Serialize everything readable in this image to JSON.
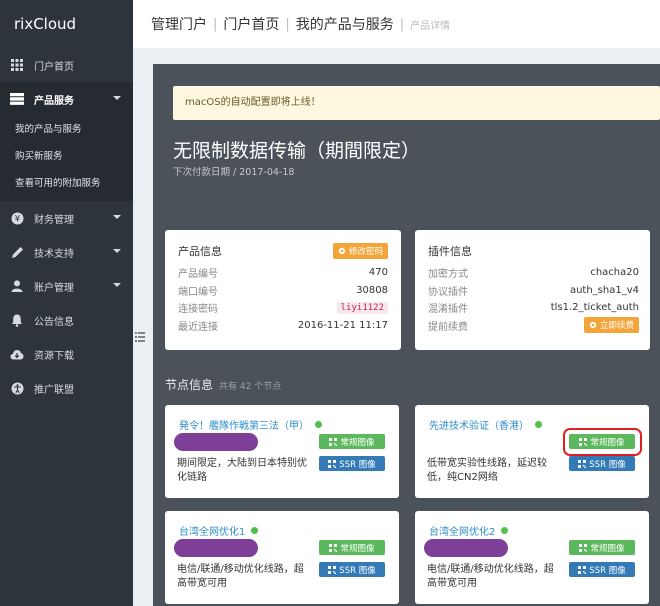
{
  "brand": "rixCloud",
  "sidebar": {
    "items": [
      {
        "label": "门户首页",
        "icon": "grid-icon"
      },
      {
        "label": "产品服务",
        "icon": "server-icon"
      },
      {
        "label": "财务管理",
        "icon": "yen-icon"
      },
      {
        "label": "技术支持",
        "icon": "pencil-icon"
      },
      {
        "label": "账户管理",
        "icon": "user-icon"
      },
      {
        "label": "公告信息",
        "icon": "bell-icon"
      },
      {
        "label": "资源下载",
        "icon": "cloud-download-icon"
      },
      {
        "label": "推广联盟",
        "icon": "accessibility-icon"
      }
    ],
    "sub_items": [
      "我的产品与服务",
      "购买新服务",
      "查看可用的附加服务"
    ]
  },
  "breadcrumb": [
    "管理门户",
    "门户首页",
    "我的产品与服务",
    "产品详情"
  ],
  "notice": "macOS的自动配置即将上线！",
  "product": {
    "title": "无限制数据传输（期間限定）",
    "next_due": "下次付款日期 / 2017-04-18"
  },
  "product_info": {
    "title": "产品信息",
    "change_pwd": "修改密码",
    "rows": [
      {
        "k": "产品编号",
        "v": "470"
      },
      {
        "k": "端口编号",
        "v": "30808"
      },
      {
        "k": "连接密码",
        "v": "liyi1122"
      },
      {
        "k": "最近连接",
        "v": "2016-11-21 11:17"
      }
    ]
  },
  "plugin_info": {
    "title": "插件信息",
    "renew": "立即续费",
    "rows": [
      {
        "k": "加密方式",
        "v": "chacha20"
      },
      {
        "k": "协议插件",
        "v": "auth_sha1_v4"
      },
      {
        "k": "混淆插件",
        "v": "tls1.2_ticket_auth"
      },
      {
        "k": "提前续费",
        "v": ""
      }
    ]
  },
  "nodes": {
    "title": "节点信息",
    "count": "共有 42 个节点",
    "btn_normal": "常规图像",
    "btn_ssr": "SSR 图像",
    "items": [
      {
        "name": "発令！艦隊作戦第三法（甲）",
        "desc": "期间限定，大陆到日本特别优化链路"
      },
      {
        "name": "先进技术验证（香港）",
        "desc": "低带宽实验性线路，延迟较低，纯CN2网络"
      },
      {
        "name": "台湾全网优化1",
        "desc": "电信/联通/移动优化线路，超高带宽可用"
      },
      {
        "name": "台湾全网优化2",
        "desc": "电信/联通/移动优化线路，超高带宽可用"
      }
    ]
  },
  "colors": {
    "sidebar_bg": "#2e343c",
    "panel_bg": "#4c525a",
    "link_blue": "#2f8ecb",
    "btn_green": "#5cb85c",
    "btn_blue": "#337ab7",
    "btn_warn": "#f3a53a",
    "pill_purple": "#7e3f98",
    "highlight_red": "#e02020"
  }
}
